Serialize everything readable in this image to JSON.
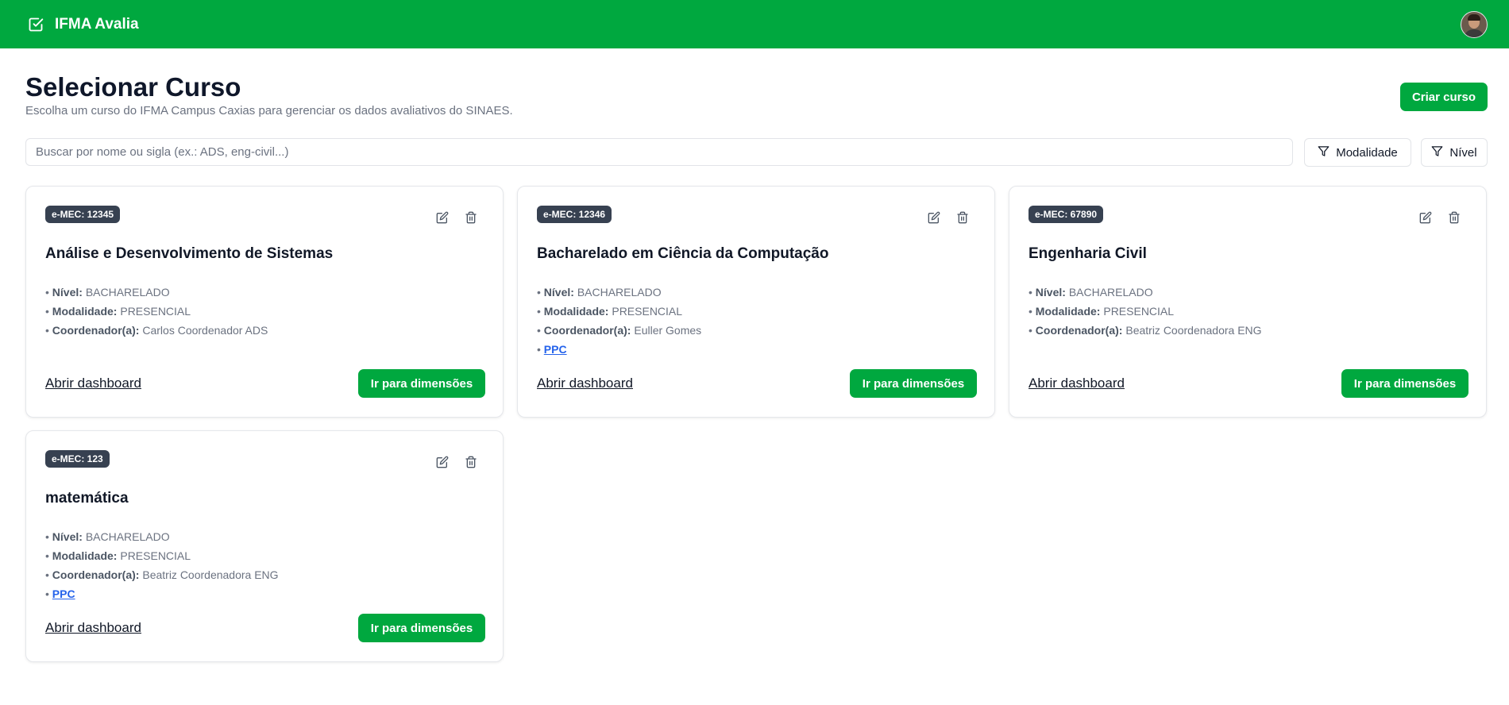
{
  "app": {
    "title": "IFMA Avalia"
  },
  "header": {
    "title": "Selecionar Curso",
    "subtitle": "Escolha um curso do IFMA Campus Caxias para gerenciar os dados avaliativos do SINAES.",
    "create_label": "Criar curso"
  },
  "search": {
    "placeholder": "Buscar por nome ou sigla (ex.: ADS, eng-civil...)",
    "value": ""
  },
  "filters": {
    "modalidade": "Modalidade",
    "nivel": "Nível"
  },
  "labels": {
    "nivel": "Nível:",
    "modalidade": "Modalidade:",
    "coordenador": "Coordenador(a):",
    "ppc": "PPC",
    "bullet": "•",
    "open_dashboard": "Abrir dashboard",
    "go_dimensions": "Ir para dimensões"
  },
  "courses": [
    {
      "emec": "e-MEC: 12345",
      "name": "Análise e Desenvolvimento de Sistemas",
      "nivel": "BACHARELADO",
      "modalidade": "PRESENCIAL",
      "coordenador": "Carlos Coordenador ADS"
    },
    {
      "emec": "e-MEC: 12346",
      "name": "Bacharelado em Ciência da Computação",
      "nivel": "BACHARELADO",
      "modalidade": "PRESENCIAL",
      "coordenador": "Euller Gomes"
    },
    {
      "emec": "e-MEC: 67890",
      "name": "Engenharia Civil",
      "nivel": "BACHARELADO",
      "modalidade": "PRESENCIAL",
      "coordenador": "Beatriz Coordenadora ENG"
    },
    {
      "emec": "e-MEC: 123",
      "name": "matemática",
      "nivel": "BACHARELADO",
      "modalidade": "PRESENCIAL",
      "coordenador": "Beatriz Coordenadora ENG"
    }
  ],
  "colors": {
    "brand": "#00a83f",
    "badge": "#374151",
    "link": "#2563eb"
  },
  "icons": {
    "brand": "checkbox-icon",
    "filter": "filter-icon",
    "edit": "edit-icon",
    "delete": "trash-icon"
  }
}
